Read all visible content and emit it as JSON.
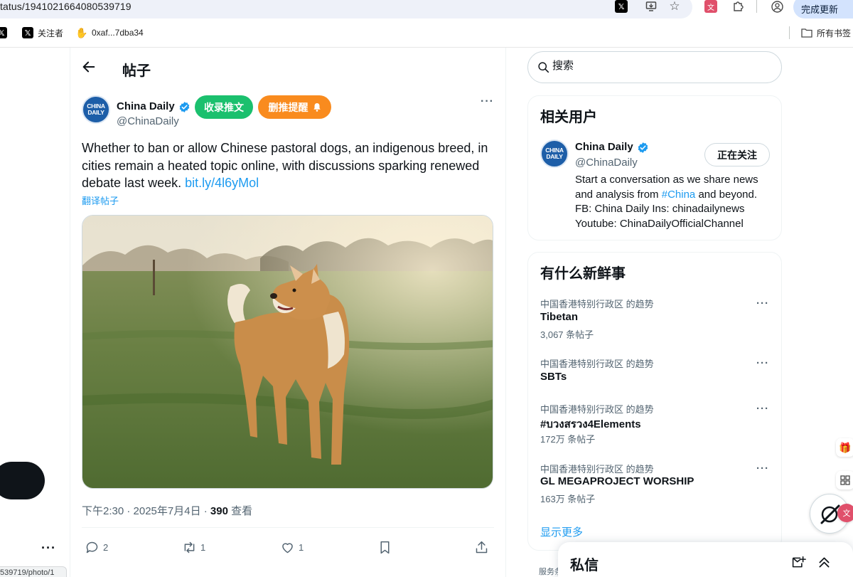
{
  "browser": {
    "url": "tatus/1941021664080539719",
    "update_button": "完成更新",
    "bookmarks": [
      {
        "icon": "x-logo-icon",
        "label": ""
      },
      {
        "icon": "x-logo-icon",
        "label": "关注者"
      },
      {
        "icon": "hand-icon",
        "label": "0xaf...7dba34"
      }
    ],
    "all_bookmarks": "所有书签",
    "status_url": "539719/photo/1"
  },
  "header": {
    "title": "帖子"
  },
  "tweet": {
    "author_name": "China Daily",
    "author_handle": "@ChinaDaily",
    "avatar_text_1": "CHINA",
    "avatar_text_2": "DAILY",
    "buttons": {
      "collect": "收录推文",
      "delete_reminder": "删推提醒"
    },
    "text": "Whether to ban or allow Chinese pastoral dogs, an indigenous breed, in cities remain a heated topic online, with discussions sparking renewed debate last week. ",
    "link": "bit.ly/4l6yMol",
    "translate": "翻译帖子",
    "time": "下午2:30 · 2025年7月4日 · ",
    "views": "390",
    "views_label": " 查看",
    "stats": {
      "replies": "2",
      "retweets": "1",
      "likes": "1"
    }
  },
  "sidebar": {
    "search_placeholder": "搜索",
    "related": {
      "title": "相关用户",
      "name": "China Daily",
      "handle": "@ChinaDaily",
      "follow": "正在关注",
      "bio_1": "Start a conversation as we share news and analysis from ",
      "bio_tag": "#China",
      "bio_2": " and beyond. FB: China Daily Ins: chinadailynews Youtube: ChinaDailyOfficialChannel"
    },
    "trends": {
      "title": "有什么新鲜事",
      "items": [
        {
          "context": "中国香港特别行政区 的趋势",
          "name": "Tibetan",
          "count": "3,067 条帖子"
        },
        {
          "context": "中国香港特别行政区 的趋势",
          "name": "SBTs",
          "count": ""
        },
        {
          "context": "中国香港特别行政区 的趋势",
          "name": "#บวงสรวง4Elements",
          "count": "172万 条帖子"
        },
        {
          "context": "中国香港特别行政区 的趋势",
          "name": "GL MEGAPROJECT WORSHIP",
          "count": "163万 条帖子"
        }
      ],
      "show_more": "显示更多"
    },
    "footer": "服务条",
    "messages": "私信"
  },
  "colors": {
    "accent": "#1d9bf0",
    "green_button": "#1bc06e",
    "orange_button": "#f98b1e",
    "verified": "#1d9bf0"
  }
}
